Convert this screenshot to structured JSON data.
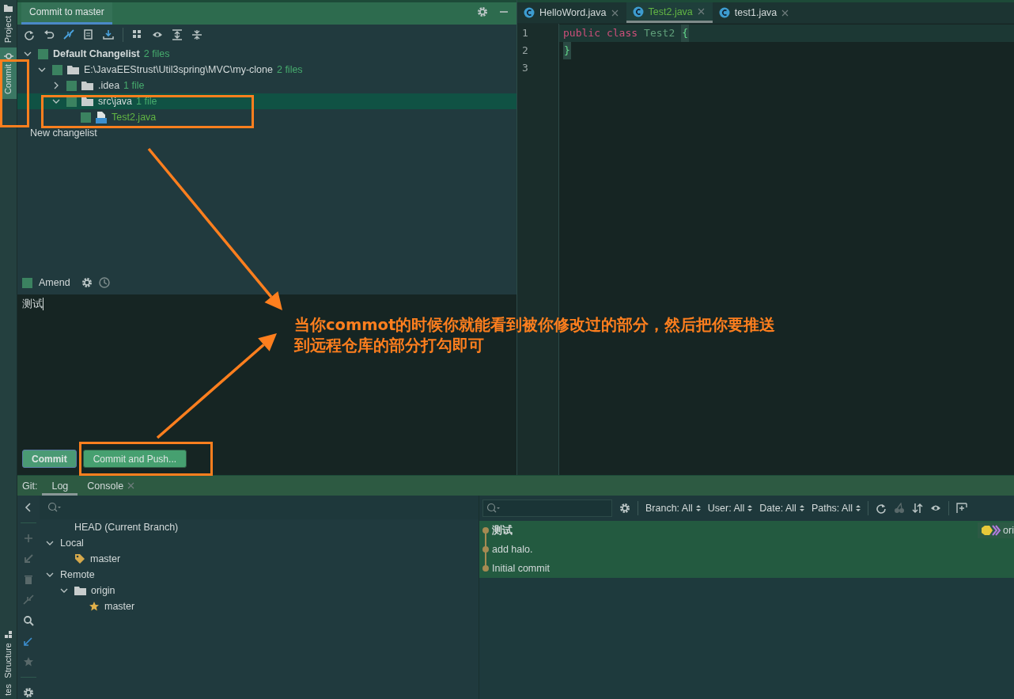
{
  "tool_stripe": {
    "top": [
      {
        "label": "Project",
        "selected": false
      },
      {
        "label": "Commit",
        "selected": true
      }
    ],
    "bottom": [
      {
        "label": "Structure"
      },
      {
        "label": "tes"
      }
    ]
  },
  "commit_panel": {
    "title": "Commit to master",
    "changes": [
      {
        "name": "Default Changelist",
        "count": "2 files",
        "kind": "changelist",
        "expanded": true,
        "checked": false,
        "selected": false,
        "children": [
          {
            "name": "E:\\JavaEEStrust\\Util3spring\\MVC\\my-clone",
            "count": "2 files",
            "kind": "folder",
            "expanded": true,
            "checked": false,
            "selected": false,
            "children": [
              {
                "name": ".idea",
                "count": "1 file",
                "kind": "folder",
                "expanded": false,
                "checked": false,
                "selected": false
              },
              {
                "name": "src\\java",
                "count": "1 file",
                "kind": "folder",
                "expanded": true,
                "checked": false,
                "selected": true,
                "children": [
                  {
                    "name": "Test2.java",
                    "kind": "file",
                    "checked": false,
                    "selected": false
                  }
                ]
              }
            ]
          }
        ]
      },
      {
        "name": "New changelist",
        "kind": "changelist-empty",
        "selected": false
      }
    ],
    "amend": {
      "label": "Amend",
      "checked": false
    },
    "message": "测试",
    "buttons": [
      {
        "label": "Commit",
        "kind": "default"
      },
      {
        "label": "Commit and Push...",
        "kind": "secondary"
      }
    ]
  },
  "editor": {
    "tabs": [
      {
        "label": "HelloWord.java",
        "selected": false
      },
      {
        "label": "Test2.java",
        "selected": true
      },
      {
        "label": "test1.java",
        "selected": false
      }
    ],
    "lines": [
      {
        "number": "1",
        "tokens": [
          {
            "text": "public",
            "kind": "keyword"
          },
          {
            "text": "class",
            "kind": "keyword"
          },
          {
            "text": "Test2",
            "kind": "name"
          },
          {
            "text": "{",
            "kind": "brace"
          }
        ]
      },
      {
        "number": "2",
        "tokens": [
          {
            "text": "}",
            "kind": "brace"
          }
        ]
      },
      {
        "number": "3"
      }
    ]
  },
  "git_panel": {
    "label": "Git:",
    "tabs": [
      {
        "label": "Log",
        "selected": true,
        "closable": false
      },
      {
        "label": "Console",
        "selected": false,
        "closable": true
      }
    ],
    "branches": [
      {
        "name": "HEAD (Current Branch)",
        "kind": "head"
      },
      {
        "name": "Local",
        "kind": "group",
        "expanded": true,
        "children": [
          {
            "name": "master",
            "kind": "local-branch"
          }
        ]
      },
      {
        "name": "Remote",
        "kind": "group",
        "expanded": true,
        "children": [
          {
            "name": "origin",
            "kind": "folder",
            "expanded": true,
            "children": [
              {
                "name": "master",
                "kind": "favorite-branch"
              }
            ]
          }
        ]
      }
    ],
    "filters": [
      "Branch: All",
      "User: All",
      "Date: All",
      "Paths: All"
    ],
    "commits": [
      {
        "message": "测试",
        "current": true,
        "selected": true,
        "refs": "ori"
      },
      {
        "message": "add halo.",
        "current": false,
        "selected": true
      },
      {
        "message": "Initial commit",
        "current": false,
        "selected": true
      }
    ]
  },
  "annotation": {
    "text": "当你**commot**的时候你就能看到被你修改过的部分，然后把你要推送到远程仓库的部分打勾即可"
  }
}
